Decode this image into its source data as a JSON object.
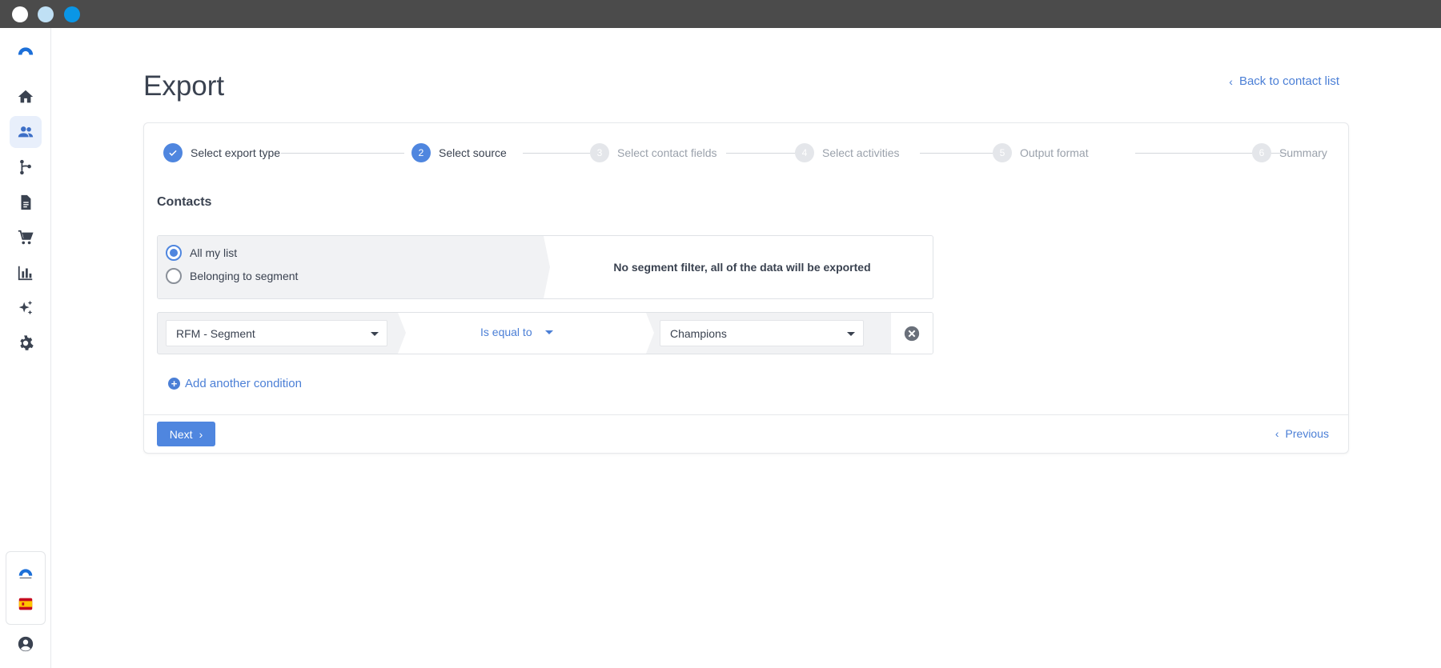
{
  "window": {
    "controls": [
      "close",
      "minimize",
      "maximize"
    ]
  },
  "sidebar": {
    "items": [
      {
        "icon": "logo-icon"
      },
      {
        "icon": "home-icon"
      },
      {
        "icon": "contacts-icon",
        "active": true
      },
      {
        "icon": "automation-icon"
      },
      {
        "icon": "document-icon"
      },
      {
        "icon": "cart-icon"
      },
      {
        "icon": "chart-icon"
      },
      {
        "icon": "sparkles-icon"
      },
      {
        "icon": "gear-icon"
      }
    ],
    "bottom": [
      {
        "icon": "brand-logo-icon"
      },
      {
        "icon": "spain-flag-icon"
      },
      {
        "icon": "user-account-icon"
      }
    ]
  },
  "header": {
    "title": "Export",
    "back_link": "Back to contact list"
  },
  "steps": [
    {
      "number": "1",
      "label": "Select export type",
      "state": "done"
    },
    {
      "number": "2",
      "label": "Select source",
      "state": "current"
    },
    {
      "number": "3",
      "label": "Select contact fields",
      "state": "todo"
    },
    {
      "number": "4",
      "label": "Select activities",
      "state": "todo"
    },
    {
      "number": "5",
      "label": "Output format",
      "state": "todo"
    },
    {
      "number": "6",
      "label": "Summary",
      "state": "todo"
    }
  ],
  "section": {
    "title": "Contacts"
  },
  "source": {
    "options": [
      {
        "label": "All my list",
        "checked": true
      },
      {
        "label": "Belonging to segment",
        "checked": false
      }
    ],
    "message": "No segment filter, all of the data will be exported"
  },
  "condition": {
    "field": "RFM - Segment",
    "operator": "Is equal to",
    "value": "Champions"
  },
  "add_condition_label": "Add another condition",
  "footer": {
    "next_label": "Next",
    "previous_label": "Previous"
  },
  "colors": {
    "accent": "#4f86df",
    "link": "#4b7fd6",
    "titlebar": "#4b4b4b"
  }
}
